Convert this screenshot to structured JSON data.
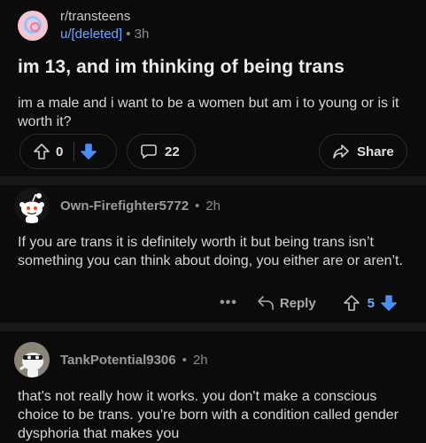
{
  "post": {
    "subreddit": "r/transteens",
    "author": "u/[deleted]",
    "separator": "•",
    "age": "3h",
    "title": "im 13, and im thinking of being trans",
    "body": "im a male and i want to be a women but am i to young or is it worth it?",
    "score": "0",
    "comment_count": "22",
    "share_label": "Share"
  },
  "comments": [
    {
      "author": "Own-Firefighter5772",
      "age": "2h",
      "body": "If you are trans it is definitely worth it but being trans isn’t something you can think about doing, you either are or aren’t.",
      "more_label": "•••",
      "reply_label": "Reply",
      "score": "5"
    },
    {
      "author": "TankPotential9306",
      "age": "2h",
      "body": "that's not really how it works. you don't make a conscious choice to be trans. you're born with a condition called gender dysphoria that makes you"
    }
  ],
  "colors": {
    "background": "#0b0b0b",
    "accent_blue": "#6fa8ff",
    "upvoted_blue": "#4a8df6"
  },
  "icons": [
    "upvote-icon",
    "downvote-icon",
    "comment-icon",
    "share-icon",
    "reply-icon"
  ]
}
